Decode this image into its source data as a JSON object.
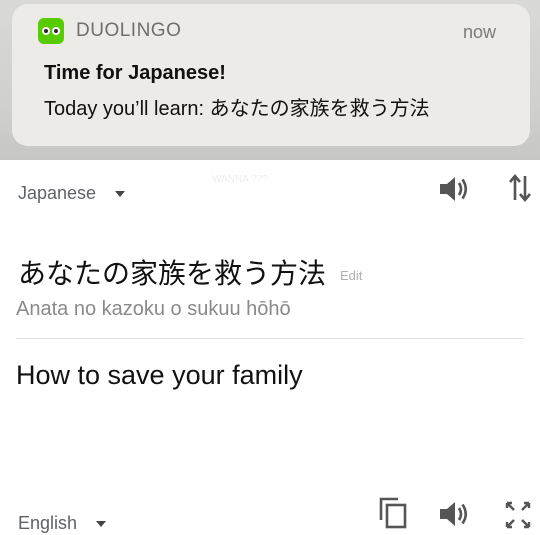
{
  "notification": {
    "app_name": "DUOLINGO",
    "time": "now",
    "title": "Time for Japanese!",
    "body": "Today you’ll learn: あなたの家族を救う方法",
    "accent_color": "#58cc02"
  },
  "background_text": "WANNA ???",
  "translator": {
    "source_language": "Japanese",
    "source_text": "あなたの家族を救う方法",
    "edit_label": "Edit",
    "romanization": "Anata no kazoku o sukuu hōhō",
    "translation": "How to save your family",
    "target_language": "English",
    "icons": {
      "speaker_top": "speaker-icon",
      "swap": "swap-languages-icon",
      "copy": "copy-icon",
      "speaker_bottom": "speaker-icon",
      "expand": "fullscreen-icon"
    }
  }
}
